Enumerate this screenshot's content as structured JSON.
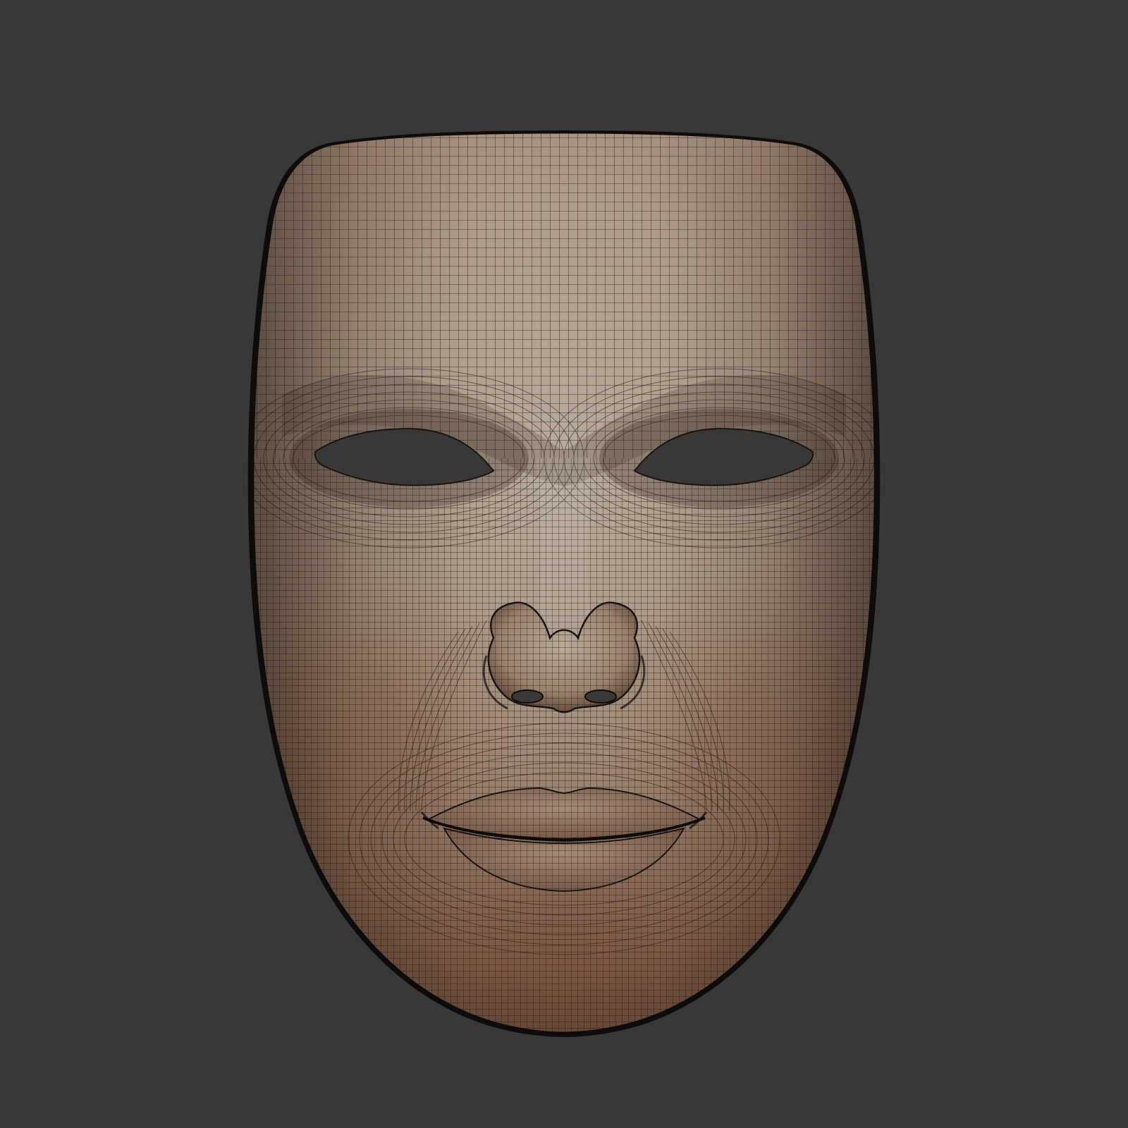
{
  "scene": {
    "subject": "wireframe-face-mask",
    "colors": {
      "background": "#383838",
      "skin_light": "#b3a696",
      "skin_mid": "#9e8b78",
      "skin_warm": "#8e6a55",
      "skin_shadow": "#5a4436",
      "wire": "#1a1410",
      "rim": "#0e0c0b"
    }
  }
}
